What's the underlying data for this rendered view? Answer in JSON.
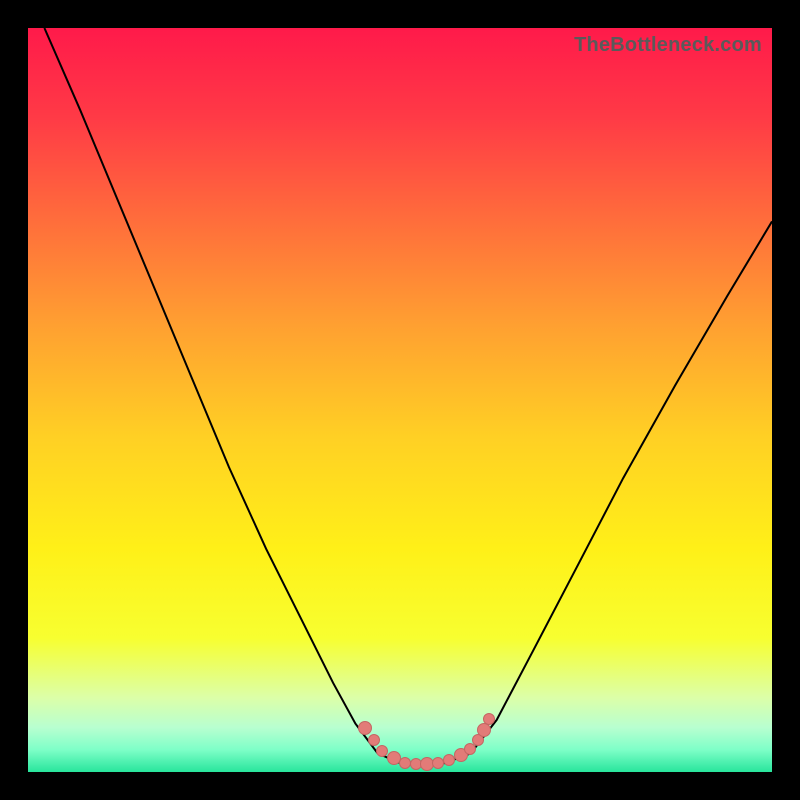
{
  "watermark": "TheBottleneck.com",
  "colors": {
    "black": "#000000",
    "marker_fill": "#e27b78",
    "marker_stroke": "#c46663",
    "curve_stroke": "#000000"
  },
  "gradient_stops": [
    {
      "offset": 0.0,
      "color": "#ff1a4a"
    },
    {
      "offset": 0.12,
      "color": "#ff3a46"
    },
    {
      "offset": 0.25,
      "color": "#ff6a3c"
    },
    {
      "offset": 0.4,
      "color": "#ffa031"
    },
    {
      "offset": 0.55,
      "color": "#ffd024"
    },
    {
      "offset": 0.7,
      "color": "#fff018"
    },
    {
      "offset": 0.82,
      "color": "#f7ff30"
    },
    {
      "offset": 0.9,
      "color": "#dcffa8"
    },
    {
      "offset": 0.94,
      "color": "#b8ffd0"
    },
    {
      "offset": 0.97,
      "color": "#7effc8"
    },
    {
      "offset": 1.0,
      "color": "#28e59c"
    }
  ],
  "chart_data": {
    "type": "line",
    "title": "",
    "xlabel": "",
    "ylabel": "",
    "xlim": [
      0,
      1
    ],
    "ylim": [
      0,
      1
    ],
    "curve_points": [
      {
        "x": 0.022,
        "y": 1.0
      },
      {
        "x": 0.07,
        "y": 0.89
      },
      {
        "x": 0.12,
        "y": 0.77
      },
      {
        "x": 0.17,
        "y": 0.65
      },
      {
        "x": 0.22,
        "y": 0.53
      },
      {
        "x": 0.27,
        "y": 0.41
      },
      {
        "x": 0.32,
        "y": 0.3
      },
      {
        "x": 0.37,
        "y": 0.2
      },
      {
        "x": 0.41,
        "y": 0.12
      },
      {
        "x": 0.44,
        "y": 0.065
      },
      {
        "x": 0.47,
        "y": 0.025
      },
      {
        "x": 0.5,
        "y": 0.012
      },
      {
        "x": 0.53,
        "y": 0.01
      },
      {
        "x": 0.56,
        "y": 0.012
      },
      {
        "x": 0.595,
        "y": 0.025
      },
      {
        "x": 0.63,
        "y": 0.07
      },
      {
        "x": 0.68,
        "y": 0.165
      },
      {
        "x": 0.74,
        "y": 0.28
      },
      {
        "x": 0.8,
        "y": 0.395
      },
      {
        "x": 0.87,
        "y": 0.52
      },
      {
        "x": 0.94,
        "y": 0.64
      },
      {
        "x": 1.0,
        "y": 0.74
      }
    ],
    "markers": [
      {
        "x": 0.452,
        "y": 0.06
      },
      {
        "x": 0.463,
        "y": 0.045
      },
      {
        "x": 0.475,
        "y": 0.03
      },
      {
        "x": 0.49,
        "y": 0.02
      },
      {
        "x": 0.505,
        "y": 0.014
      },
      {
        "x": 0.52,
        "y": 0.012
      },
      {
        "x": 0.535,
        "y": 0.012
      },
      {
        "x": 0.55,
        "y": 0.014
      },
      {
        "x": 0.565,
        "y": 0.018
      },
      {
        "x": 0.58,
        "y": 0.024
      },
      {
        "x": 0.593,
        "y": 0.032
      },
      {
        "x": 0.603,
        "y": 0.044
      },
      {
        "x": 0.612,
        "y": 0.058
      },
      {
        "x": 0.618,
        "y": 0.072
      }
    ]
  }
}
